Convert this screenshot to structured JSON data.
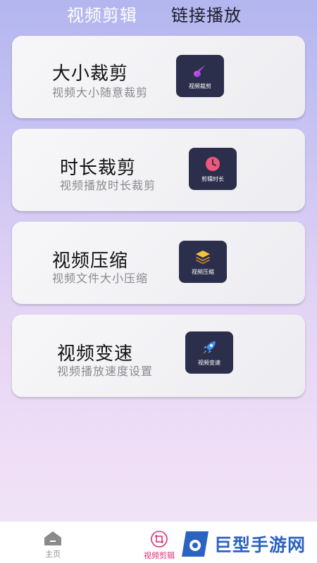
{
  "tabs": {
    "video_edit": "视频剪辑",
    "link_play": "链接播放"
  },
  "cards": [
    {
      "title": "大小裁剪",
      "subtitle": "视频大小随意裁剪",
      "badge_label": "视频裁剪",
      "icon": "brush-icon"
    },
    {
      "title": "时长裁剪",
      "subtitle": "视频播放时长裁剪",
      "badge_label": "剪辑时长",
      "icon": "clock-icon"
    },
    {
      "title": "视频压缩",
      "subtitle": "视频文件大小压缩",
      "badge_label": "视频压缩",
      "icon": "layers-icon"
    },
    {
      "title": "视频变速",
      "subtitle": "视频播放速度设置",
      "badge_label": "视频变速",
      "icon": "rocket-icon"
    }
  ],
  "bottom_nav": {
    "home_label": "主页",
    "edit_label": "视频剪辑"
  },
  "watermark": {
    "text": "巨型手游网"
  },
  "colors": {
    "badge_bg": "#2c2f4c",
    "active_nav": "#e02c74",
    "watermark_blue": "#2a63c2"
  }
}
